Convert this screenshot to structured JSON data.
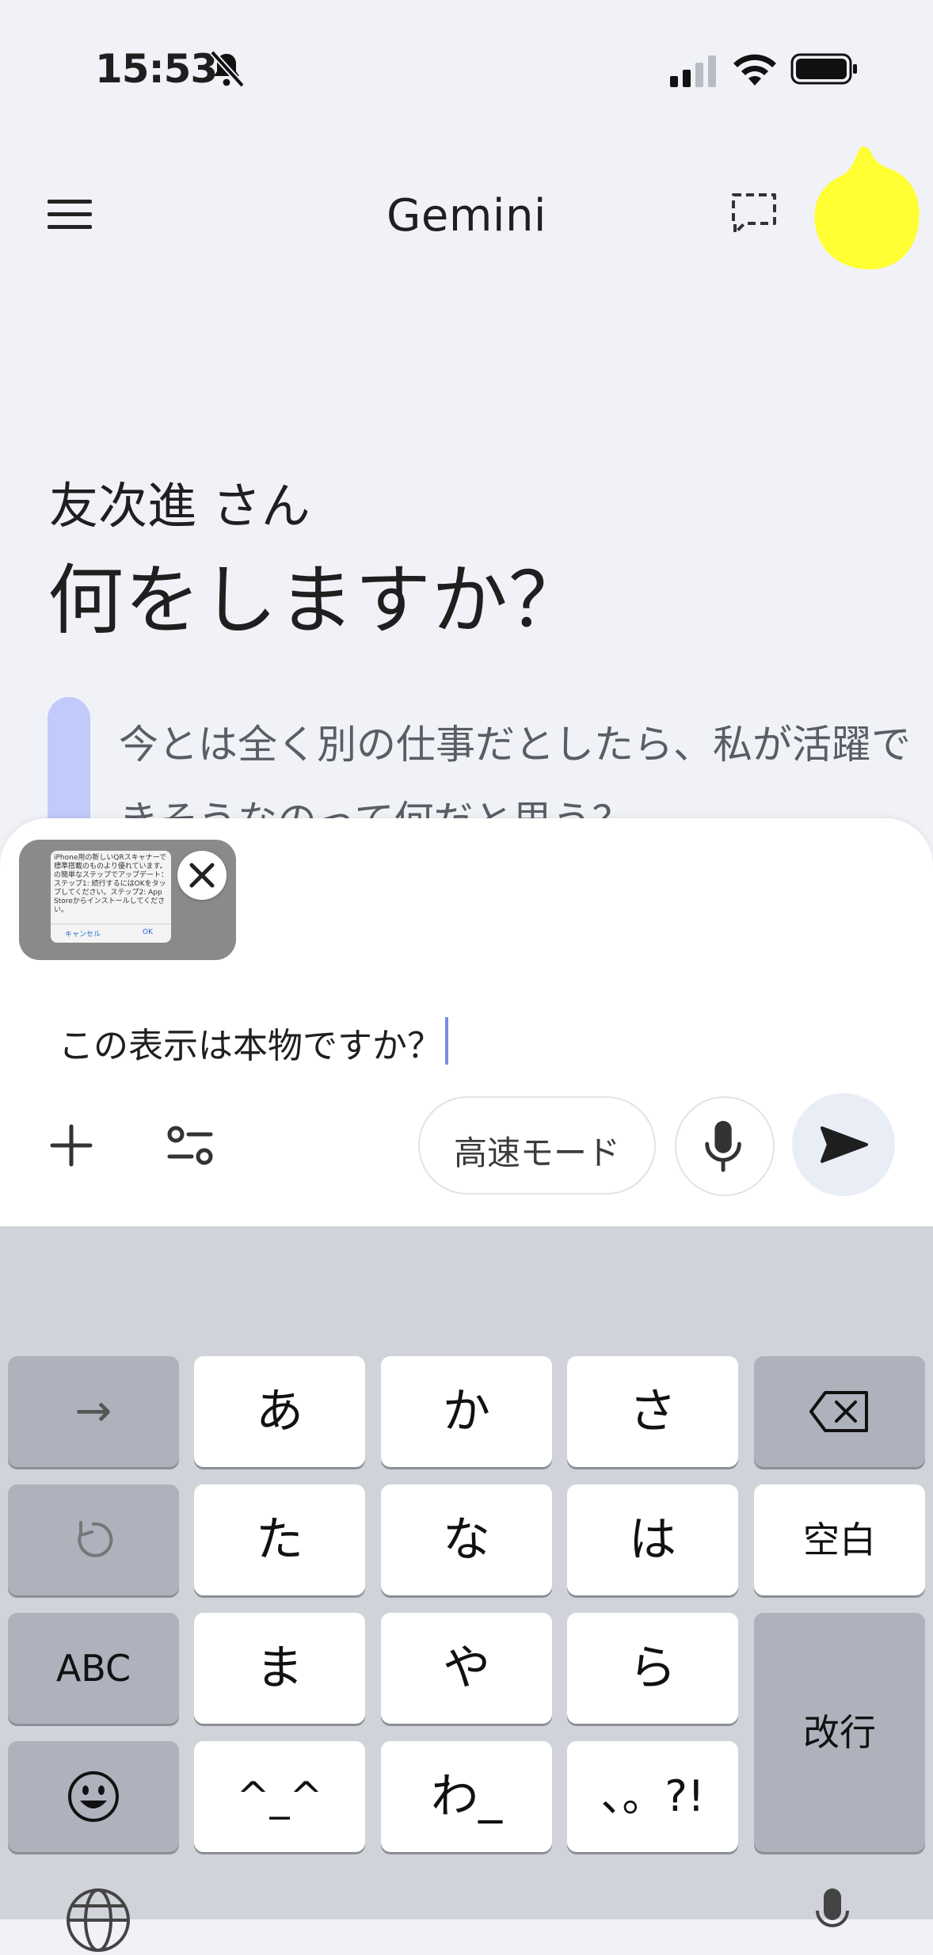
{
  "status_bar": {
    "time": "15:53",
    "icons": [
      "bell-off-icon",
      "cellular-signal-icon",
      "wifi-icon",
      "battery-icon"
    ]
  },
  "header": {
    "title": "Gemini",
    "menu_icon": "hamburger-menu-icon",
    "new_chat_icon": "new-chat-icon",
    "avatar_color": "#ffff33"
  },
  "greeting": {
    "name": "友次進 さん",
    "question": "何をしますか？"
  },
  "suggestion": {
    "text": "今とは全く別の仕事だとしたら、私が活躍できそうなのって何だと思う？",
    "accent_color": "#c2c9fb"
  },
  "attachment": {
    "preview_text": "iPhone用の新しいQRスキャナーで標準搭載のものより優れています。の簡単なステップでアップデート：ステップ1: 続行するにはOKをタップしてください。ステップ2: App Storeからインストールしてください。",
    "preview_cancel": "キャンセル",
    "preview_ok": "OK"
  },
  "input": {
    "value": "この表示は本物ですか？",
    "mode_label": "高速モード",
    "send_icon": "send-icon",
    "mic_icon": "microphone-icon",
    "add_icon": "plus-icon",
    "tools_icon": "tools-sliders-icon"
  },
  "keyboard": {
    "keys": {
      "next": "→",
      "a": "あ",
      "ka": "か",
      "sa": "さ",
      "ta": "た",
      "na": "な",
      "ha": "は",
      "space": "空白",
      "abc": "ABC",
      "ma": "ま",
      "ya": "や",
      "ra": "ら",
      "return": "改行",
      "kaomoji": "^_^",
      "wa": "わ_",
      "punct": "、。?!"
    }
  }
}
